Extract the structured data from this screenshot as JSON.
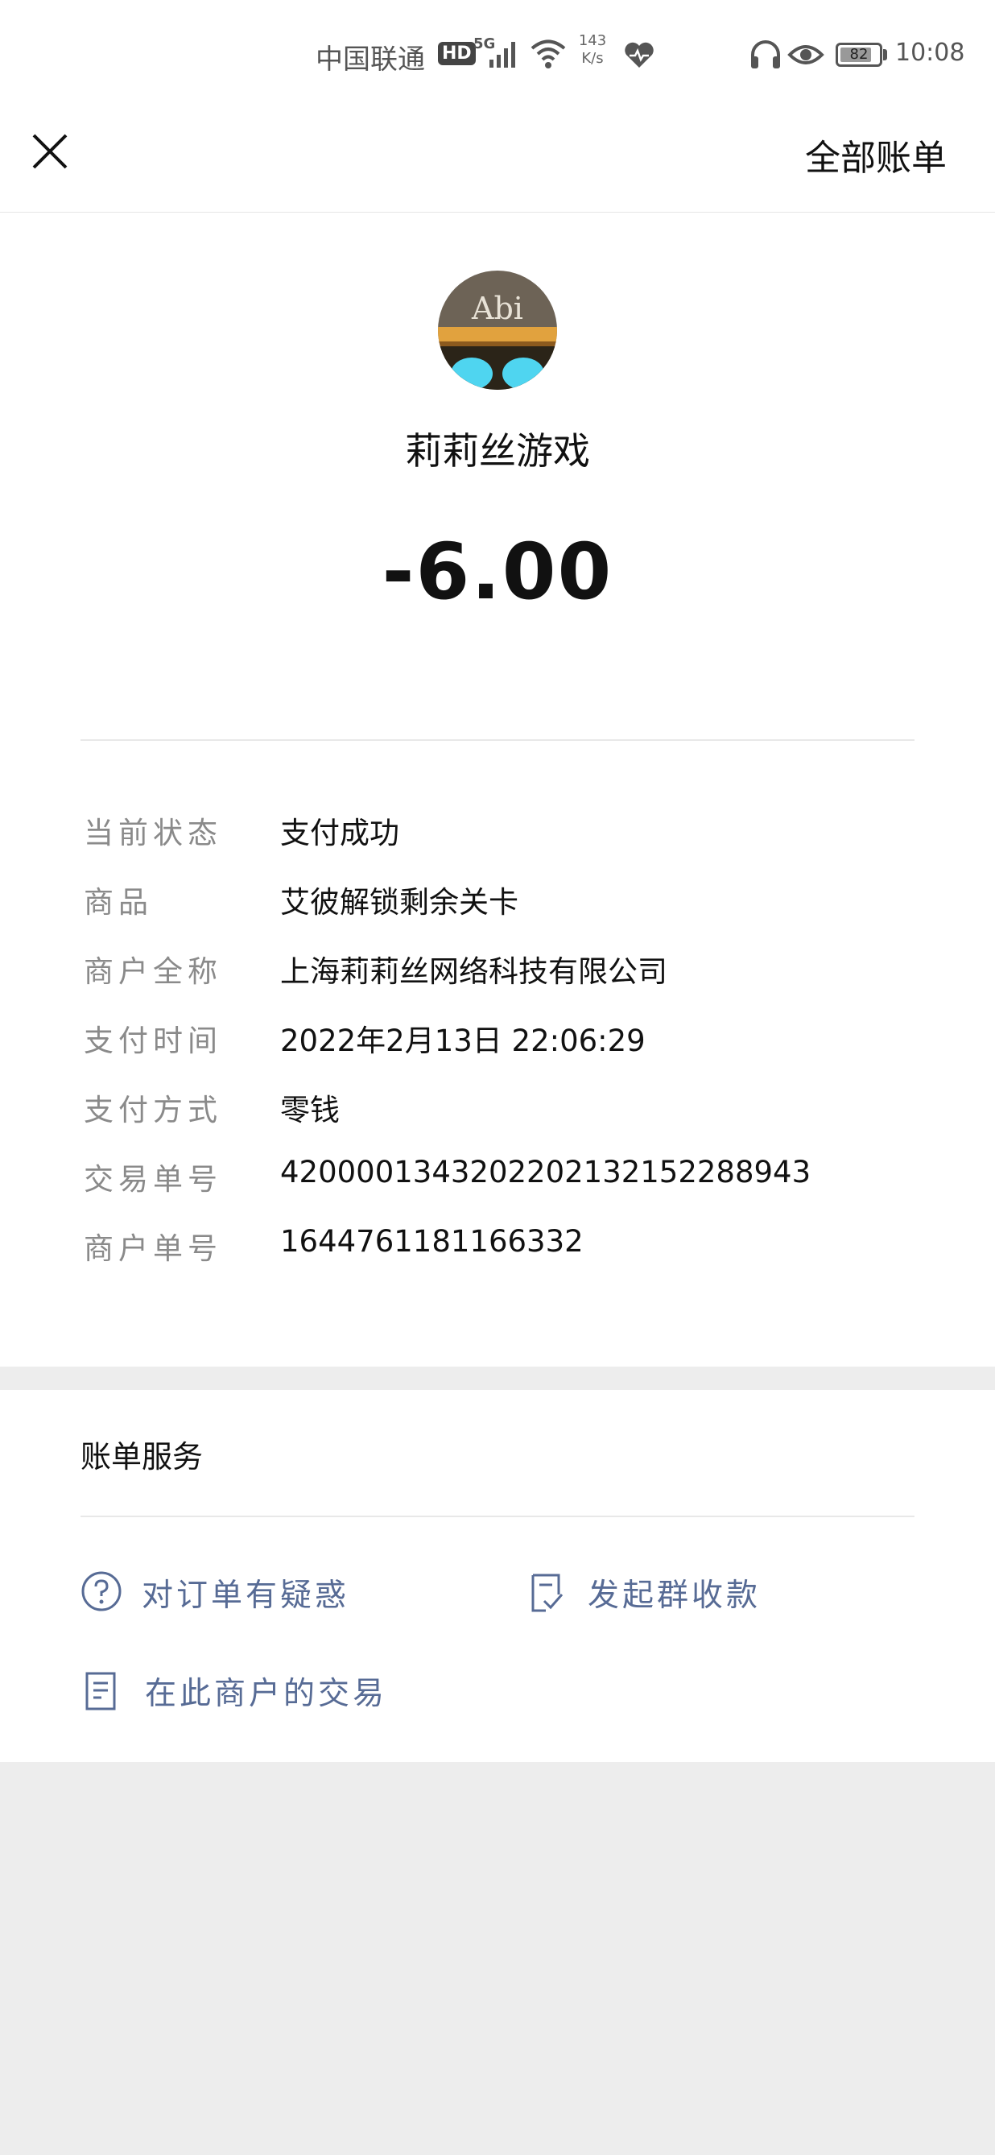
{
  "status_bar": {
    "carrier": "中国联通",
    "hd": "HD",
    "network": "5G",
    "speed_value": "143",
    "speed_unit": "K/s",
    "battery": "82",
    "battery_level": 0.82,
    "time": "10:08"
  },
  "header": {
    "close_icon": "close-icon",
    "all_bills": "全部账单"
  },
  "merchant": {
    "avatar_text": "Abi",
    "name": "莉莉丝游戏"
  },
  "amount": "-6.00",
  "details": [
    {
      "label": "当前状态",
      "value": "支付成功"
    },
    {
      "label": "商品",
      "value": "艾彼解锁剩余关卡"
    },
    {
      "label": "商户全称",
      "value": "上海莉莉丝网络科技有限公司"
    },
    {
      "label": "支付时间",
      "value": "2022年2月13日 22:06:29"
    },
    {
      "label": "支付方式",
      "value": "零钱"
    },
    {
      "label": "交易单号",
      "value": "4200001343202202132152288943"
    },
    {
      "label": "商户单号",
      "value": "1644761181166332"
    }
  ],
  "services": {
    "title": "账单服务",
    "items": [
      {
        "label": "对订单有疑惑",
        "icon": "question-circle-icon"
      },
      {
        "label": "发起群收款",
        "icon": "checklist-icon"
      },
      {
        "label": "在此商户的交易",
        "icon": "document-icon"
      }
    ]
  },
  "colors": {
    "link": "#576b95",
    "page_bg": "#ededed"
  }
}
